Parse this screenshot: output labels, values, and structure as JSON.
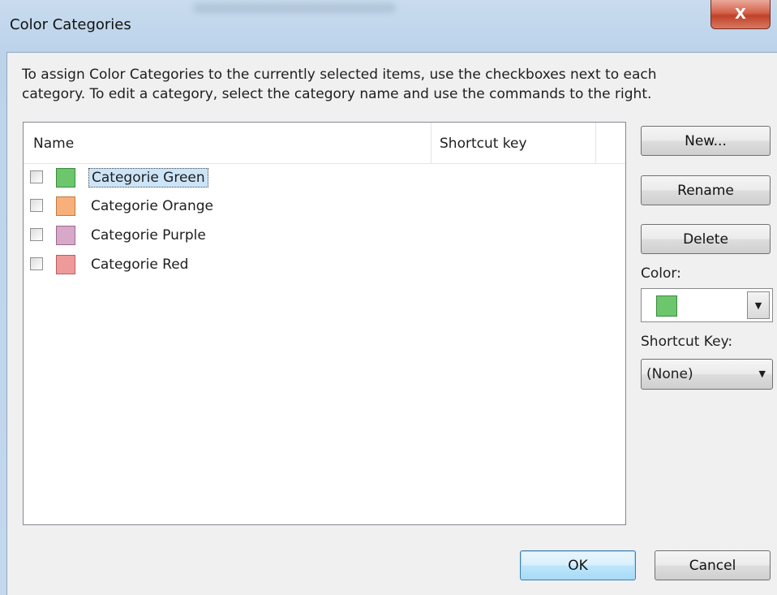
{
  "window": {
    "title": "Color Categories",
    "close_glyph": "X"
  },
  "instructions": {
    "line1": "To assign Color Categories to the currently selected items, use the checkboxes next to each",
    "line2": "category.  To edit a category, select the category name and use the commands to the right."
  },
  "list": {
    "columns": {
      "name": "Name",
      "shortcut": "Shortcut key"
    },
    "items": [
      {
        "label": "Categorie Green",
        "checked": false,
        "color": "#6cc66c",
        "border": "#3d8a3d",
        "selected": true
      },
      {
        "label": "Categorie Orange",
        "checked": false,
        "color": "#f8b07a",
        "border": "#c07a44",
        "selected": false
      },
      {
        "label": "Categorie Purple",
        "checked": false,
        "color": "#d7a8c8",
        "border": "#9c6b8e",
        "selected": false
      },
      {
        "label": "Categorie Red",
        "checked": false,
        "color": "#ef9a9a",
        "border": "#b85f5f",
        "selected": false
      }
    ]
  },
  "side": {
    "new_label": "New...",
    "rename_label": "Rename",
    "delete_label": "Delete",
    "color_label": "Color:",
    "color_value": "#6cc66c",
    "shortcut_label": "Shortcut Key:",
    "shortcut_value": "(None)"
  },
  "footer": {
    "ok_label": "OK",
    "cancel_label": "Cancel"
  }
}
